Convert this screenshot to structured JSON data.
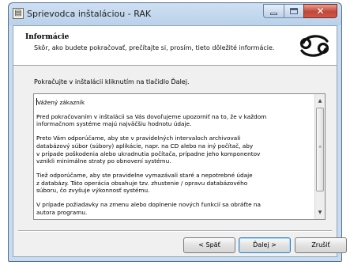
{
  "window": {
    "title": "Sprievodca inštaláciou - RAK"
  },
  "header": {
    "title": "Informácie",
    "subtitle": "Skôr, ako budete pokračovať, prečítajte si, prosím, tieto dôležité informácie."
  },
  "logo": {
    "name": "cancer-zodiac-icon"
  },
  "instruction": "Pokračujte v inštalácii kliknutím na tlačidlo Ďalej.",
  "info_text": {
    "paragraphs": [
      "Vážený zákazník",
      "Pred pokračovaním v inštalácii sa Vás dovoľujeme upozorniť na to, že v každom\ninformačnom systéme majú najväčšiu hodnotu údaje.",
      "Preto Vám odporúčame, aby ste v pravidelných intervaloch archivovali\ndatabázový súbor (súbory) aplikácie, napr. na CD alebo na iný počítač, aby\nv prípade poškodenia alebo ukradnutia počítača, prípadne jeho komponentov\nvznikli minimálne straty po obnovení systému.",
      "Tiež odporúčame, aby ste pravidelne vymazávali staré a nepotrebné údaje\nz databázy. Táto operácia obsahuje tzv. zhustenie / opravu databázového\nsúboru, čo zvyšuje výkonnosť systému.",
      "V prípade požiadavky na zmenu alebo doplnenie nových funkcií sa obráťte na\nautora programu."
    ]
  },
  "buttons": {
    "back": "< Späť",
    "next": "Ďalej >",
    "cancel": "Zrušiť"
  }
}
